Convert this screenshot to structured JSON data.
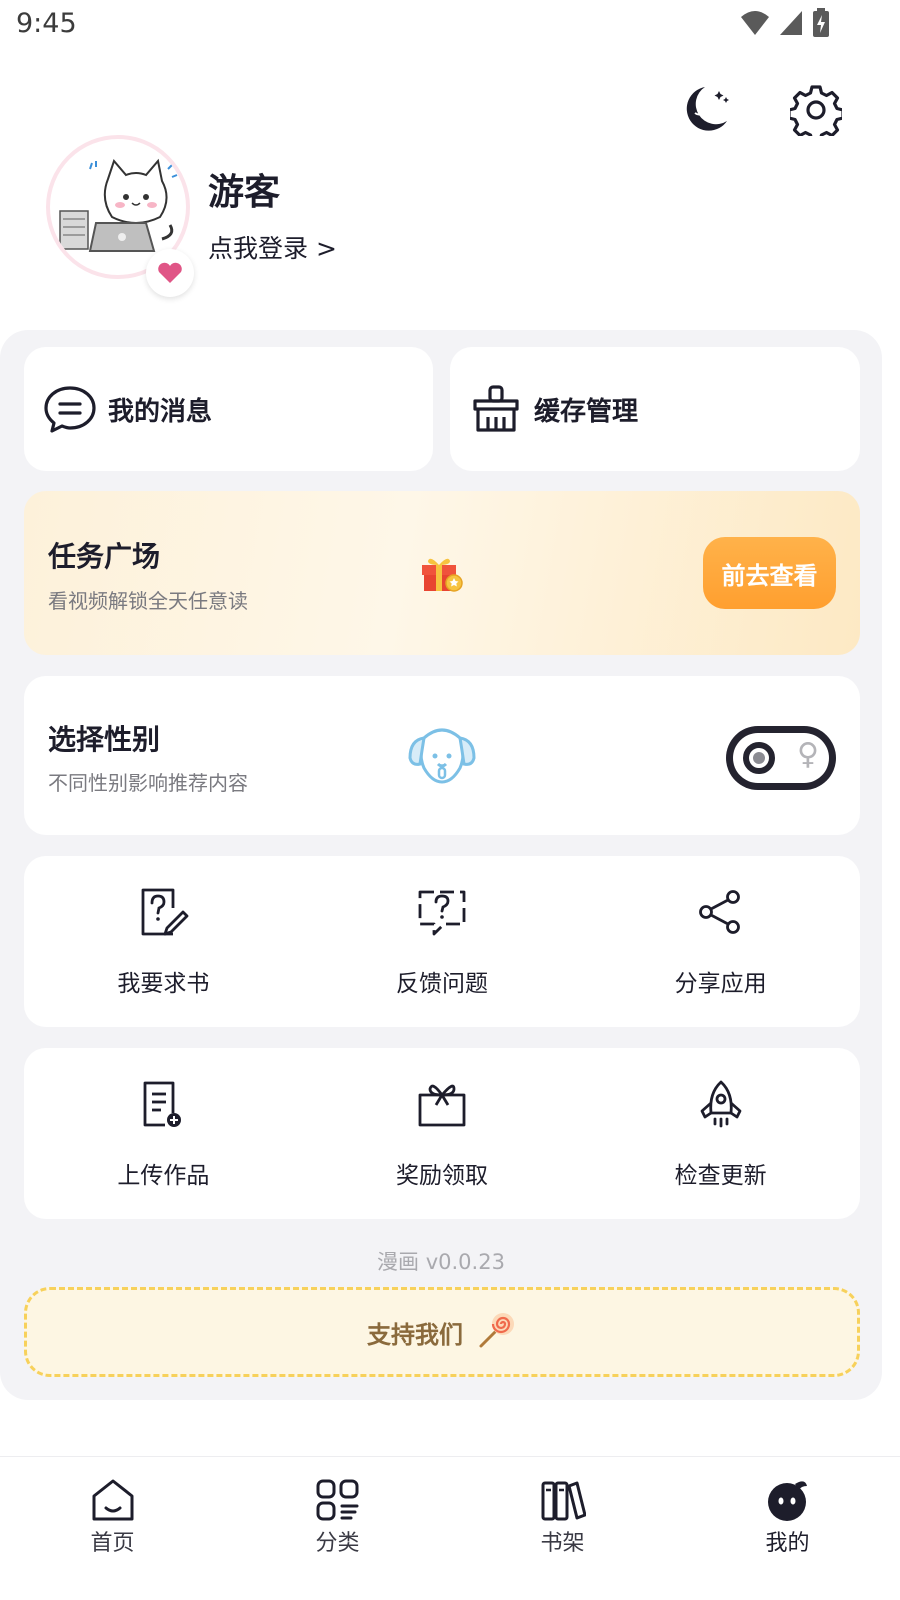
{
  "status_bar": {
    "time": "9:45",
    "icons": [
      "wifi-icon",
      "cellular-icon",
      "battery-charging-icon"
    ]
  },
  "top_actions": {
    "icons": [
      "night-mode-icon",
      "settings-icon"
    ]
  },
  "profile": {
    "name": "游客",
    "login_text": "点我登录 >",
    "avatar": "cat-avatar",
    "badge": "heart-icon"
  },
  "quick_actions": [
    {
      "label": "我的消息",
      "icon": "message-icon"
    },
    {
      "label": "缓存管理",
      "icon": "broom-icon"
    }
  ],
  "task_square": {
    "title": "任务广场",
    "subtitle": "看视频解锁全天任意读",
    "button": "前去查看",
    "icon": "gift-icon"
  },
  "gender": {
    "title": "选择性别",
    "subtitle": "不同性别影响推荐内容",
    "icon": "dog-icon",
    "toggle_symbol": "♀"
  },
  "grid_row1": [
    {
      "label": "我要求书",
      "icon": "request-book-icon"
    },
    {
      "label": "反馈问题",
      "icon": "feedback-icon"
    },
    {
      "label": "分享应用",
      "icon": "share-icon"
    }
  ],
  "grid_row2": [
    {
      "label": "上传作品",
      "icon": "upload-doc-icon"
    },
    {
      "label": "奖励领取",
      "icon": "reward-gift-icon"
    },
    {
      "label": "检查更新",
      "icon": "rocket-icon"
    }
  ],
  "version": "漫画 v0.0.23",
  "support": {
    "label": "支持我们",
    "icon": "lollipop-icon"
  },
  "tabbar": [
    {
      "label": "首页",
      "icon": "home-icon"
    },
    {
      "label": "分类",
      "icon": "category-icon"
    },
    {
      "label": "书架",
      "icon": "bookshelf-icon"
    },
    {
      "label": "我的",
      "icon": "profile-icon",
      "active": true
    }
  ],
  "colors": {
    "accent_orange": "#ff9f2f",
    "task_bg": "#fdf1da",
    "panel_bg": "#f3f3f6",
    "dark": "#24232f",
    "support_border": "#f7d15b"
  }
}
